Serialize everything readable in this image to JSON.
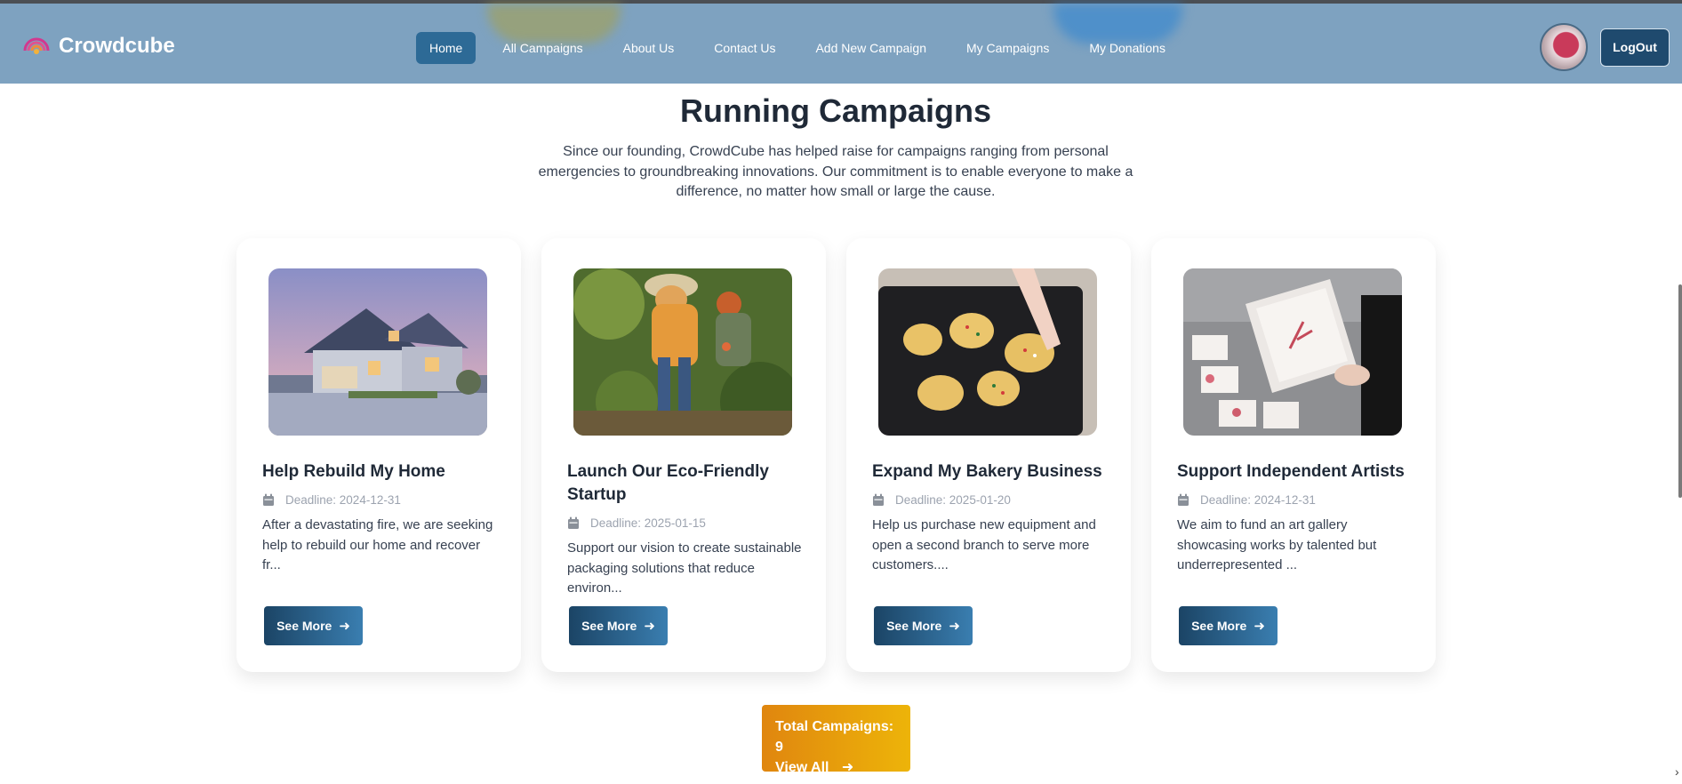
{
  "brand": {
    "name": "Crowdcube"
  },
  "nav": {
    "links": [
      "Home",
      "All Campaigns",
      "About Us",
      "Contact Us",
      "Add New Campaign",
      "My Campaigns",
      "My Donations"
    ],
    "active": "Home",
    "logout_label": "LogOut"
  },
  "hero": {
    "title": "Running Campaigns",
    "subtitle": "Since our founding, CrowdCube has helped raise for campaigns ranging from personal emergencies to groundbreaking innovations. Our commitment is to enable everyone to make a difference, no matter how small or large the cause."
  },
  "campaigns": [
    {
      "title": "Help Rebuild My Home",
      "deadline": "Deadline: 2024-12-31",
      "description": "After a devastating fire, we are seeking help to rebuild our home and recover fr...",
      "button": "See More",
      "image_icon": "house-photo"
    },
    {
      "title": "Launch Our Eco-Friendly Startup",
      "deadline": "Deadline: 2025-01-15",
      "description": "Support our vision to create sustainable packaging solutions that reduce environ...",
      "button": "See More",
      "image_icon": "farmers-photo"
    },
    {
      "title": "Expand My Bakery Business",
      "deadline": "Deadline: 2025-01-20",
      "description": "Help us purchase new equipment and open a second branch to serve more customers....",
      "button": "See More",
      "image_icon": "cookies-photo"
    },
    {
      "title": "Support Independent Artists",
      "deadline": "Deadline: 2024-12-31",
      "description": "We aim to fund an art gallery showcasing works by talented but underrepresented ...",
      "button": "See More",
      "image_icon": "tablet-art-photo"
    }
  ],
  "footer_cta": {
    "total_label": "Total Campaigns: 9",
    "view_all_label": "View All"
  },
  "colors": {
    "navbar": "#7a9fbe",
    "active_nav": "#2d6a96",
    "button_dark": "#1b4465",
    "cta_orange": "#e0860f",
    "cta_yellow": "#edb409"
  }
}
